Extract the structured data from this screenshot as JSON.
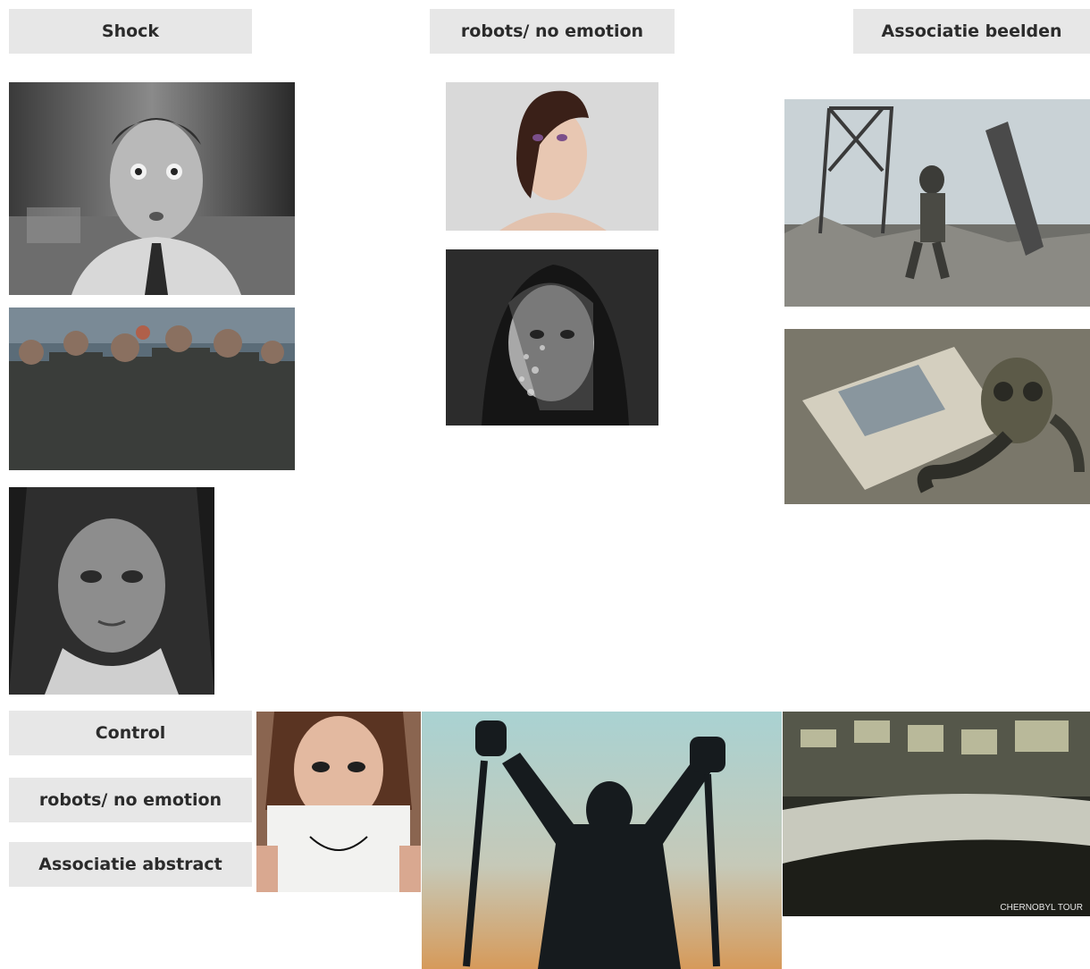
{
  "labels": {
    "shock": "Shock",
    "robots_top": "robots/ no emotion",
    "associatie_beelden": "Associatie beelden",
    "control": "Control",
    "robots_bottom": "robots/ no emotion",
    "associatie_abstract": "Associatie abstract"
  },
  "images": {
    "shocked_man": {
      "icon": "shocked-man-photo"
    },
    "miners_group": {
      "icon": "miners-crowd-photo"
    },
    "weary_woman": {
      "icon": "distressed-woman-photo"
    },
    "faceless_person": {
      "icon": "faceless-person-photo"
    },
    "shadow_face_woman": {
      "icon": "shadow-face-woman-photo"
    },
    "tower_ruins": {
      "icon": "ruins-worker-photo"
    },
    "gas_mask": {
      "icon": "gas-mask-photo"
    },
    "smile_sign": {
      "icon": "smile-sign-photo"
    },
    "broken_chains": {
      "icon": "broken-chains-silhouette-photo"
    },
    "control_room": {
      "icon": "control-room-photo",
      "watermark": "CHERNOBYL TOUR"
    }
  },
  "colors": {
    "label_bg": "#e7e7e7",
    "label_text": "#2b2b2b"
  }
}
